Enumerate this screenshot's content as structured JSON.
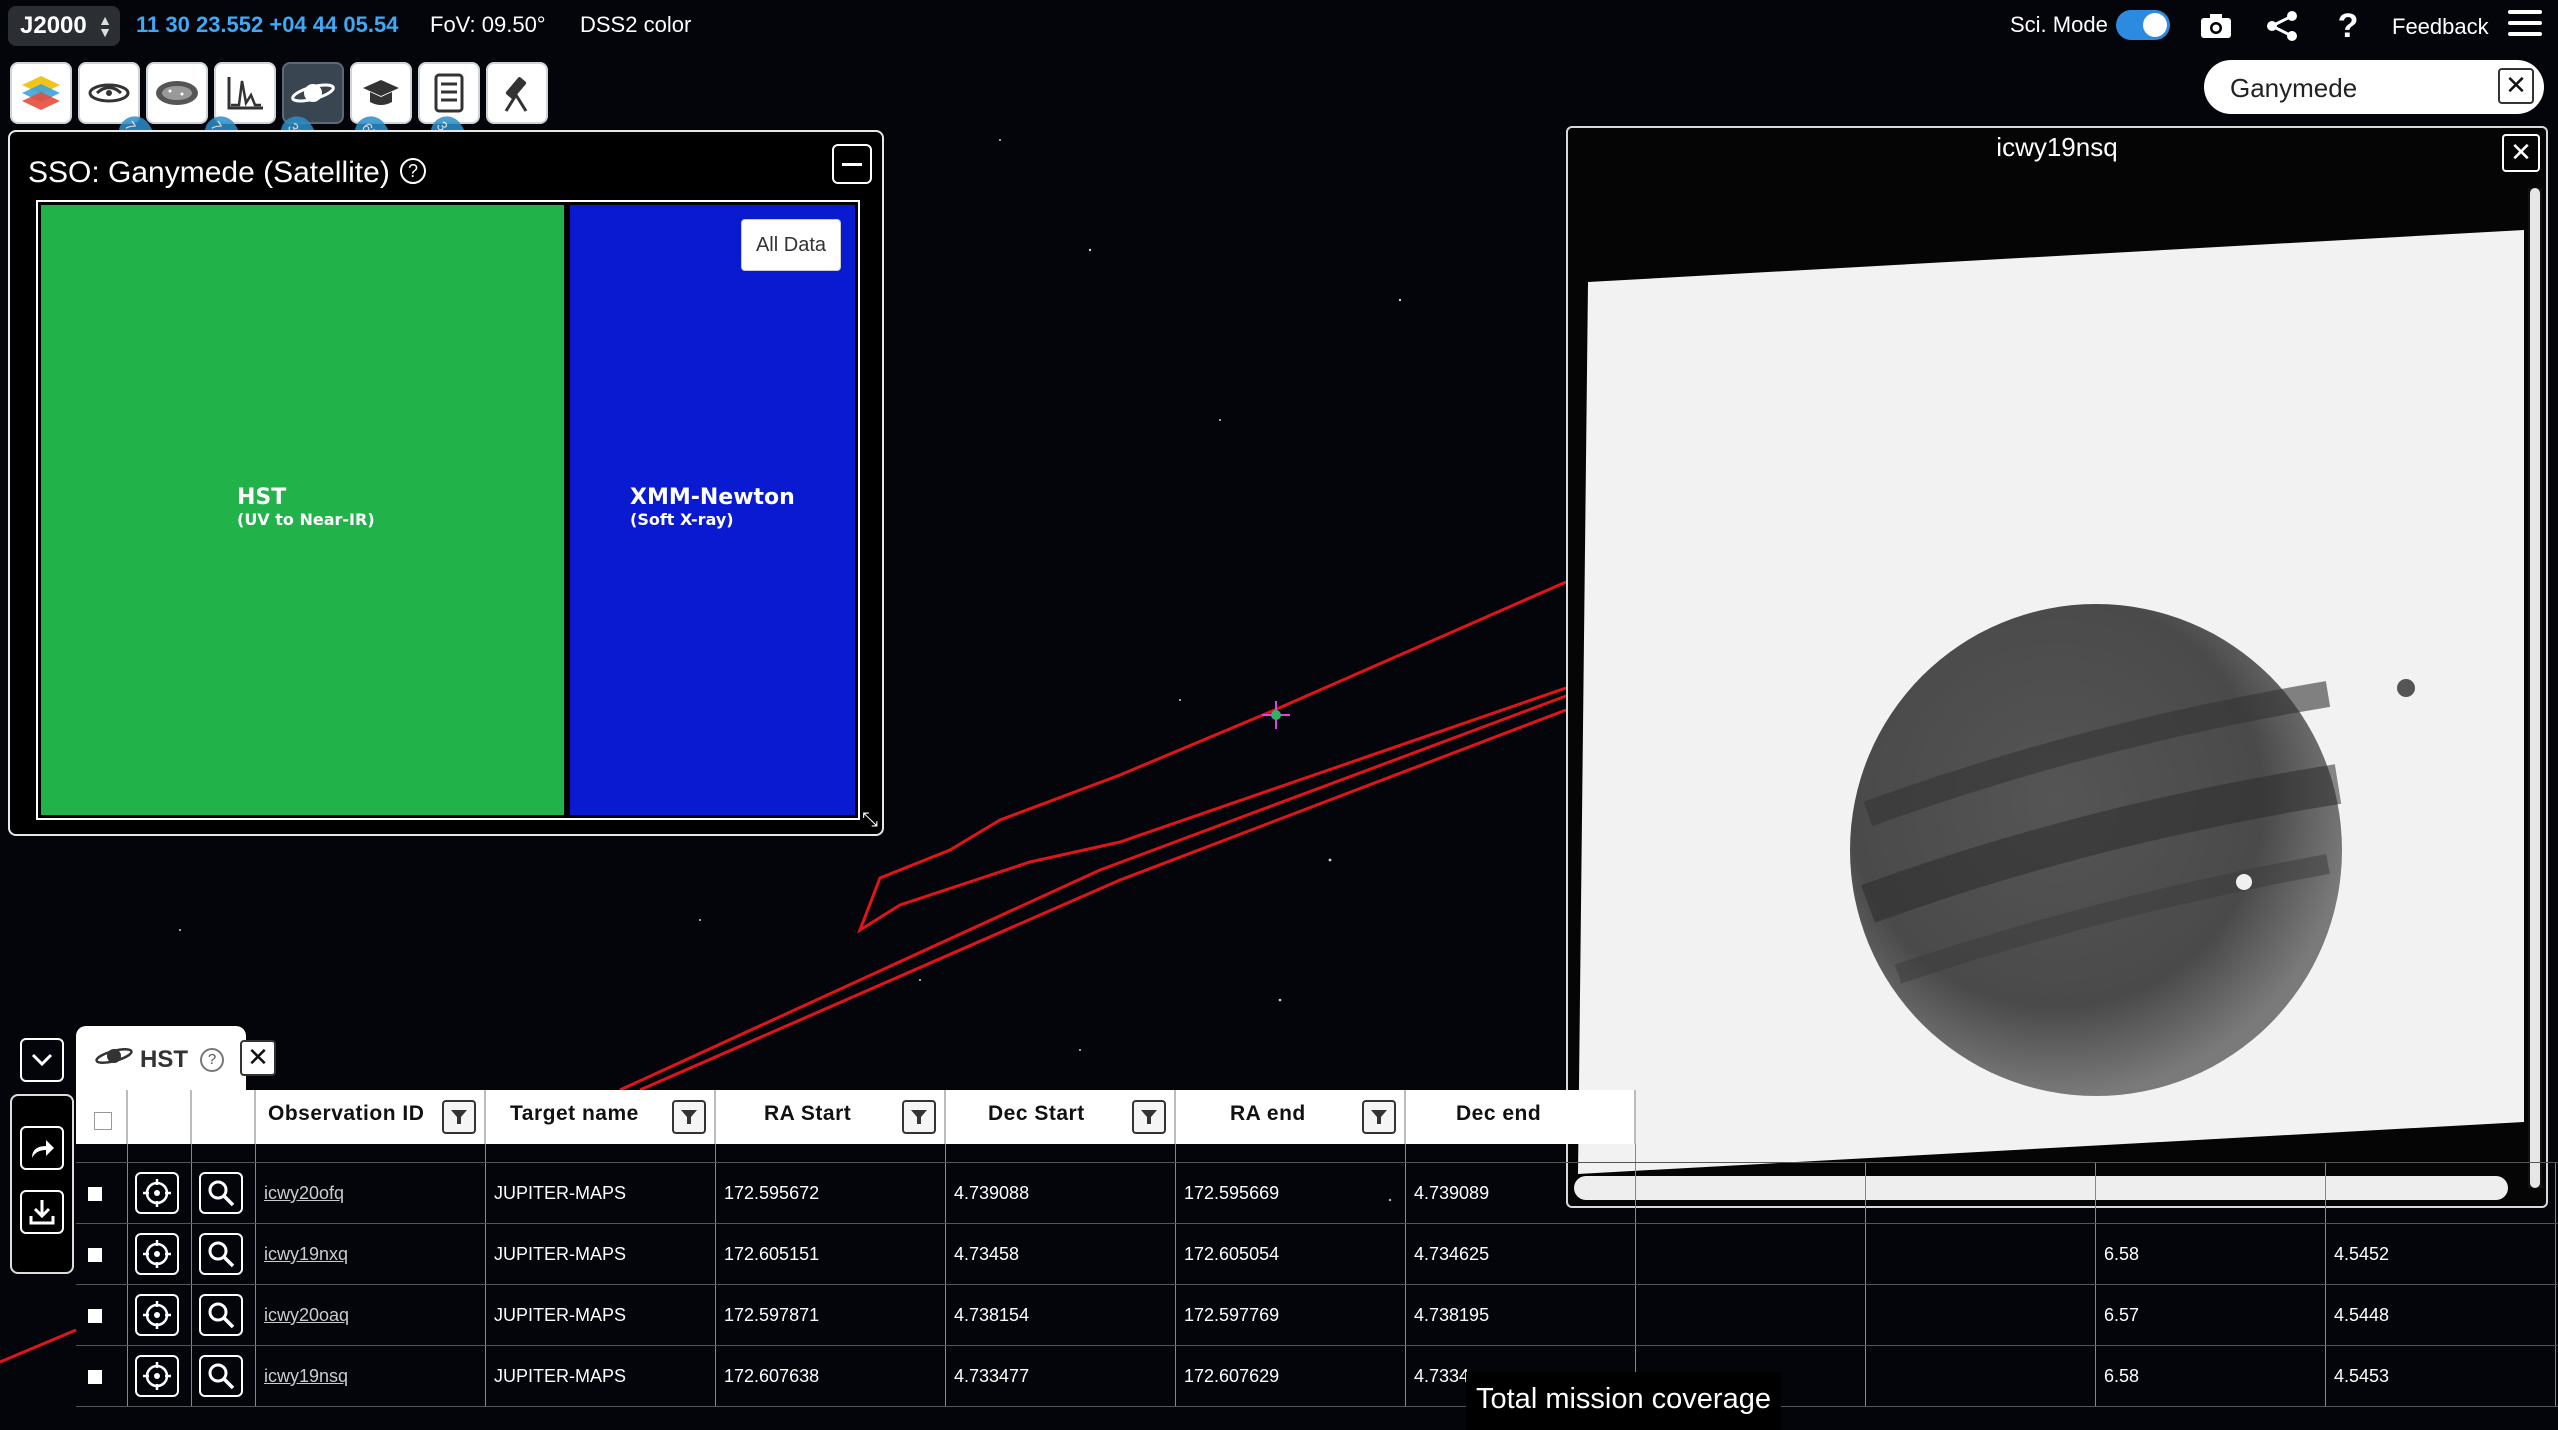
{
  "topbar": {
    "frame": "J2000",
    "coordinates": "11 30 23.552 +04 44 05.54",
    "fov": "FoV: 09.50°",
    "survey": "DSS2 color",
    "sci_mode_label": "Sci. Mode",
    "sci_mode_on": true,
    "feedback_label": "Feedback",
    "icons": [
      "camera-icon",
      "share-icon",
      "help-icon",
      "menu-icon"
    ]
  },
  "toolbar": {
    "tools": [
      "layers-icon",
      "galaxy-icon",
      "catalog-icon",
      "spectra-icon",
      "planet-icon",
      "outreach-icon",
      "publications-icon",
      "telescope-icon"
    ],
    "active_tool": "planet-icon",
    "badges": [
      "7 24",
      "7 48",
      "396",
      "654",
      "34 6"
    ]
  },
  "search": {
    "value": "Ganymede",
    "clear_label": "✕"
  },
  "sso_panel": {
    "title": "SSO: Ganymede (Satellite)",
    "help_label": "?",
    "all_data_label": "All Data",
    "treemap": [
      {
        "name": "HST",
        "range": "(UV to Near-IR)",
        "color": "#21b34a",
        "share": 0.645
      },
      {
        "name": "XMM-Newton",
        "range": "(Soft X-ray)",
        "color": "#0a1ad0",
        "share": 0.355
      }
    ]
  },
  "preview": {
    "title": "icwy19nsq",
    "close_label": "✕"
  },
  "results": {
    "tab_label": "HST",
    "tab_help": "?",
    "tab_close": "✕",
    "columns": [
      "Observation ID",
      "Target name",
      "RA Start",
      "Dec Start",
      "RA end",
      "Dec end"
    ],
    "rows": [
      {
        "id": "icwy20ofq",
        "target": "JUPITER-MAPS",
        "ra_start": "172.595672",
        "dec_start": "4.739088",
        "ra_end": "172.595669",
        "dec_end": "4.739089",
        "c1": "",
        "c2": "",
        "c3": "",
        "c4": ""
      },
      {
        "id": "icwy19nxq",
        "target": "JUPITER-MAPS",
        "ra_start": "172.605151",
        "dec_start": "4.73458",
        "ra_end": "172.605054",
        "dec_end": "4.734625",
        "c1": "",
        "c2": "",
        "c3": "6.58",
        "c4": "4.5452"
      },
      {
        "id": "icwy20oaq",
        "target": "JUPITER-MAPS",
        "ra_start": "172.597871",
        "dec_start": "4.738154",
        "ra_end": "172.597769",
        "dec_end": "4.738195",
        "c1": "",
        "c2": "",
        "c3": "6.57",
        "c4": "4.5448"
      },
      {
        "id": "icwy19nsq",
        "target": "JUPITER-MAPS",
        "ra_start": "172.607638",
        "dec_start": "4.733477",
        "ra_end": "172.607629",
        "dec_end": "4.7334",
        "c1": "",
        "c2": "",
        "c3": "6.58",
        "c4": "4.5453"
      }
    ],
    "coverage_label": "Total mission coverage"
  },
  "colors": {
    "accent": "#3fa9f5",
    "orbit": "#e0141b",
    "hst": "#21b34a",
    "xmm": "#0a1ad0"
  }
}
